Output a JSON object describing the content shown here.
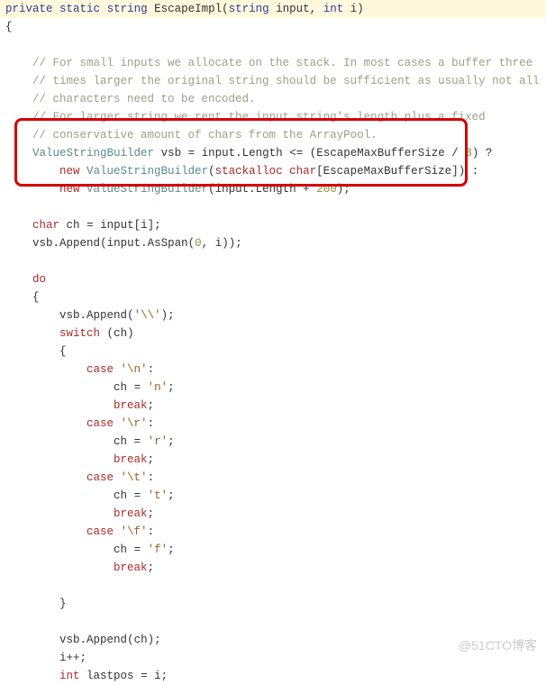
{
  "signature": {
    "kw_private": "private",
    "kw_static": "static",
    "kw_string": "string",
    "method": "EscapeImpl",
    "paren_open": "(",
    "p1_type": "string",
    "p1_name": "input",
    "comma": ",",
    "p2_type": "int",
    "p2_name": "i",
    "paren_close": ")"
  },
  "c1": "// For small inputs we allocate on the stack. In most cases a buffer three",
  "c2": "// times larger the original string should be sufficient as usually not all",
  "c3": "// characters need to be encoded.",
  "c4": "// For larger string we rent the input string's length plus a fixed",
  "c5": "// conservative amount of chars from the ArrayPool.",
  "vsb": {
    "type": "ValueStringBuilder",
    "name": "vsb",
    "eq": "=",
    "input": "input",
    "dot": ".",
    "length": "Length",
    "le": "<=",
    "open": "(",
    "maxbuf": "EscapeMaxBufferSize",
    "slash": "/",
    "three": "3",
    "close": ")",
    "tern": "?",
    "new": "new",
    "stackalloc": "stackalloc",
    "char": "char",
    "lbrack": "[",
    "rbrack": "]",
    "colon": ":",
    "plus": "+",
    "two00": "200",
    "semi": ";"
  },
  "ch_decl": {
    "char": "char",
    "ch": "ch",
    "eq": "=",
    "input": "input",
    "lbrack": "[",
    "i": "i",
    "rbrack": "]",
    "semi": ";"
  },
  "append_span": {
    "vsb": "vsb",
    "dot": ".",
    "append": "Append",
    "open": "(",
    "input": "input",
    "asspan": "AsSpan",
    "zero": "0",
    "comma": ",",
    "i": "i",
    "close": ")",
    "semi": ";"
  },
  "do_kw": "do",
  "brace_open": "{",
  "brace_close": "}",
  "append_bs": {
    "vsb": "vsb",
    "dot": ".",
    "append": "Append",
    "open": "(",
    "lit": "'\\\\'",
    "close": ")",
    "semi": ";"
  },
  "switch": {
    "kw": "switch",
    "open": "(",
    "ch": "ch",
    "close": ")"
  },
  "case": {
    "kw": "case",
    "break": "break",
    "semi": ";",
    "eq": "=",
    "ch": "ch",
    "colon": ":",
    "n_lit": "'\\n'",
    "n_val": "'n'",
    "r_lit": "'\\r'",
    "r_val": "'r'",
    "t_lit": "'\\t'",
    "t_val": "'t'",
    "f_lit": "'\\f'",
    "f_val": "'f'"
  },
  "append_ch": {
    "vsb": "vsb",
    "dot": ".",
    "append": "Append",
    "open": "(",
    "ch": "ch",
    "close": ")",
    "semi": ";"
  },
  "ipp": "i++;",
  "lastpos": {
    "int": "int",
    "name": "lastpos",
    "eq": "=",
    "i": "i",
    "semi": ";"
  },
  "watermark": "@51CTO博客"
}
